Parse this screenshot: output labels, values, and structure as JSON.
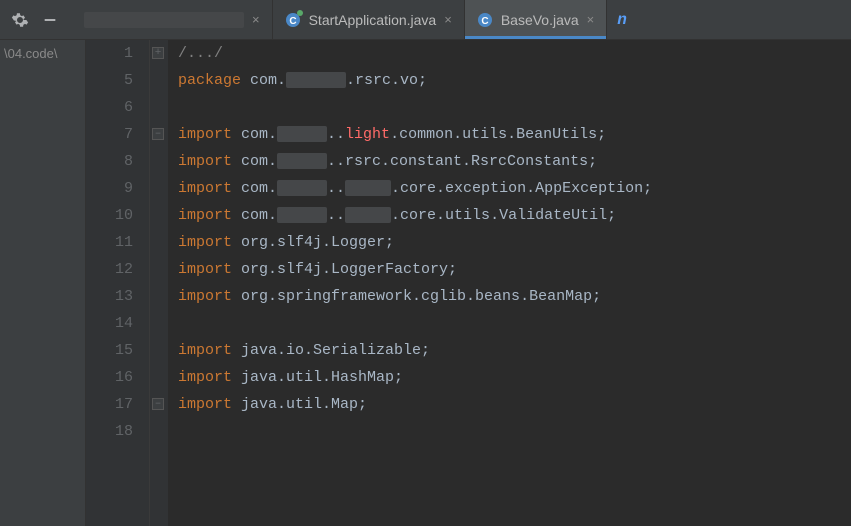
{
  "topbar": {
    "gear_icon": "gear-icon",
    "minimize_icon": "minimize-icon"
  },
  "tabs": [
    {
      "label": "",
      "icon": "hidden",
      "active": false
    },
    {
      "label": "StartApplication.java",
      "icon": "class-run",
      "active": false,
      "closeable": true
    },
    {
      "label": "BaseVo.java",
      "icon": "class",
      "active": true,
      "closeable": true
    }
  ],
  "extra_tab_hint": "n",
  "side_panel": {
    "path": "\\04.code\\"
  },
  "gutter": {
    "lines": [
      "1",
      "5",
      "6",
      "7",
      "8",
      "9",
      "10",
      "11",
      "12",
      "13",
      "14",
      "15",
      "16",
      "17",
      "18"
    ]
  },
  "folds": [
    {
      "row": 0,
      "symbol": "+"
    },
    {
      "row": 3,
      "symbol": "–"
    },
    {
      "row": 13,
      "symbol": "–"
    }
  ],
  "code_lines": [
    {
      "type": "comment",
      "text": "/.../"
    },
    {
      "type": "package",
      "kw": "package",
      "parts_pre": " com.",
      "redact_w": 60,
      "parts_post": ".rsrc.vo;"
    },
    {
      "type": "blank"
    },
    {
      "type": "import",
      "kw": "import",
      "pre": " com.",
      "redact_w": 50,
      "mid": "..",
      "hot": "light",
      "post": ".common.utils.BeanUtils;"
    },
    {
      "type": "import",
      "kw": "import",
      "pre": " com.",
      "redact_w": 50,
      "mid": "..rsrc.constant.RsrcConstants;",
      "hot": "",
      "post": ""
    },
    {
      "type": "import",
      "kw": "import",
      "pre": " com.",
      "redact_w": 50,
      "mid": "..",
      "redact2_w": 46,
      "post2": ".core.exception.AppException;"
    },
    {
      "type": "import",
      "kw": "import",
      "pre": " com.",
      "redact_w": 50,
      "mid": "..",
      "redact2_w": 46,
      "post2": ".core.utils.ValidateUtil;"
    },
    {
      "type": "import_plain",
      "kw": "import",
      "text": " org.slf4j.Logger;"
    },
    {
      "type": "import_plain",
      "kw": "import",
      "text": " org.slf4j.LoggerFactory;"
    },
    {
      "type": "import_plain",
      "kw": "import",
      "text": " org.springframework.cglib.beans.BeanMap;"
    },
    {
      "type": "blank"
    },
    {
      "type": "import_plain",
      "kw": "import",
      "text": " java.io.Serializable;"
    },
    {
      "type": "import_plain",
      "kw": "import",
      "text": " java.util.HashMap;"
    },
    {
      "type": "import_plain",
      "kw": "import",
      "text": " java.util.Map;"
    },
    {
      "type": "blank"
    }
  ]
}
